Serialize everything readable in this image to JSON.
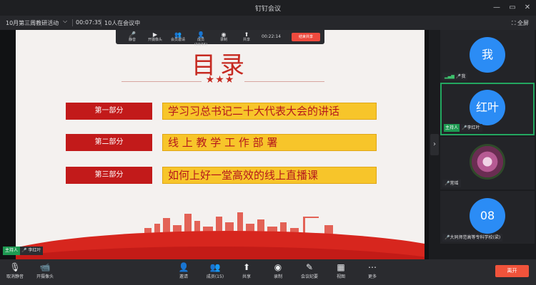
{
  "window": {
    "title": "钉钉会议",
    "minimize": "—",
    "restore": "▭",
    "close": "✕"
  },
  "infobar": {
    "meeting_name": "10月第三周教研活动",
    "chevron": "⌵",
    "elapsed": "00:07:35",
    "attendance": "10人在会议中",
    "fullscreen_label": "全屏"
  },
  "slide": {
    "heading": "目录",
    "stars": "★★★",
    "parts": [
      {
        "label": "第一部分",
        "title": "学习习总书记二十大代表大会的讲话"
      },
      {
        "label": "第二部分",
        "title": "线 上 教 学 工 作 部 署"
      },
      {
        "label": "第三部分",
        "title": "如何上好一堂高效的线上直播课"
      }
    ]
  },
  "mini_toolbar": {
    "items": [
      {
        "icon": "mic-icon",
        "glyph": "🎤",
        "label": "静音"
      },
      {
        "icon": "camera-icon",
        "glyph": "▶",
        "label": "开摄像头"
      },
      {
        "icon": "members-icon",
        "glyph": "👥",
        "label": "会员邀请"
      },
      {
        "icon": "participants-icon",
        "glyph": "👤",
        "label": "成员(10/15)"
      },
      {
        "icon": "record-icon",
        "glyph": "◉",
        "label": "录制"
      },
      {
        "icon": "share-icon",
        "glyph": "⬆",
        "label": "共享"
      }
    ],
    "timer": "00:22:14",
    "stop_label": "结束共享"
  },
  "presenter_badge": {
    "role": "主持人",
    "name": "李红叶"
  },
  "participants": [
    {
      "avatar_text": "我",
      "role": "",
      "name": "我",
      "signal": true,
      "active": false,
      "photo": false
    },
    {
      "avatar_text": "红叶",
      "role": "主持人",
      "name": "李红叶",
      "signal": false,
      "active": true,
      "photo": false
    },
    {
      "avatar_text": "",
      "role": "",
      "name": "常瑶",
      "signal": false,
      "active": false,
      "photo": true
    },
    {
      "avatar_text": "08",
      "role": "",
      "name": "大同师范高等专科学校(梁)",
      "signal": false,
      "active": false,
      "photo": false
    }
  ],
  "toolbar": {
    "mute": {
      "icon": "mic-icon",
      "glyph": "🎙",
      "label": "取消静音"
    },
    "camera": {
      "icon": "camera-icon",
      "glyph": "📹",
      "label": "开摄像头"
    },
    "invite": {
      "icon": "invite-icon",
      "glyph": "👤",
      "label": "邀请"
    },
    "members": {
      "icon": "members-icon",
      "glyph": "👥",
      "label": "成员(15)"
    },
    "share": {
      "icon": "share-icon",
      "glyph": "⬆",
      "label": "共享"
    },
    "record": {
      "icon": "record-icon",
      "glyph": "◉",
      "label": "录制"
    },
    "minutes": {
      "icon": "minutes-icon",
      "glyph": "✎",
      "label": "会议纪要"
    },
    "view": {
      "icon": "view-icon",
      "glyph": "▦",
      "label": "视图"
    },
    "more": {
      "icon": "more-icon",
      "glyph": "⋯",
      "label": "更多"
    },
    "leave_label": "离开"
  },
  "colors": {
    "accent_green": "#1e9a52",
    "slide_red": "#c21a1a",
    "slide_gold": "#f7c52a",
    "avatar_blue": "#2b8cf5",
    "leave_red": "#f0533b"
  }
}
